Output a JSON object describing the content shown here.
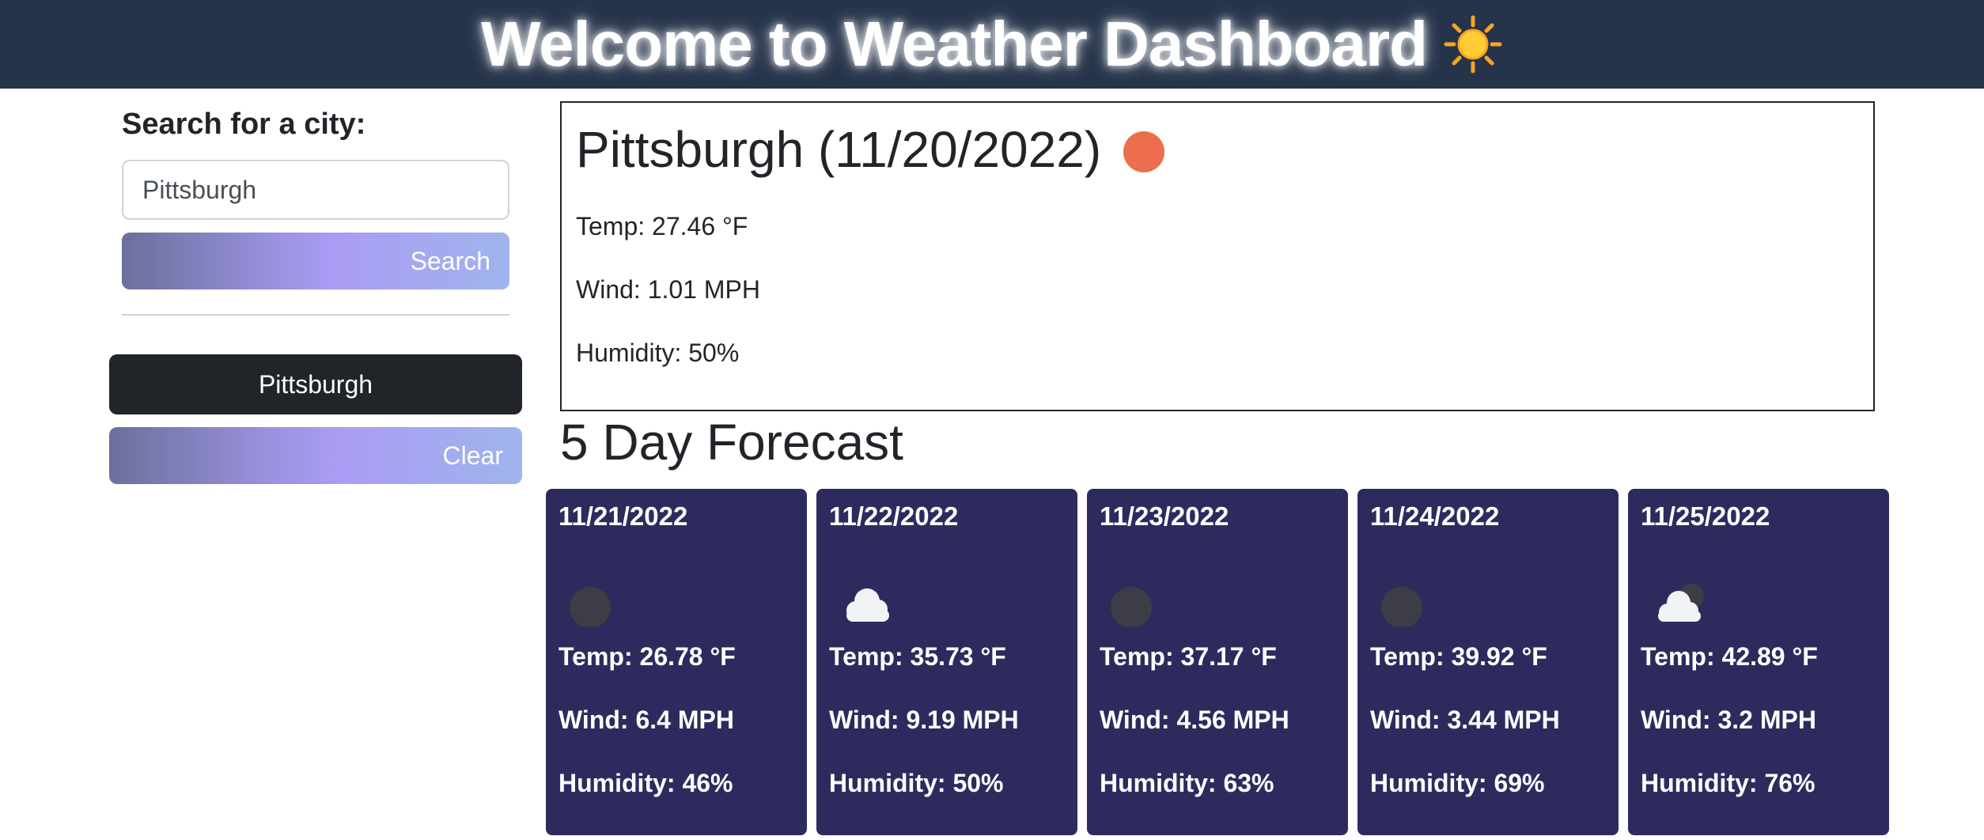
{
  "header": {
    "title": "Welcome to Weather Dashboard",
    "icon": "sun-icon"
  },
  "sidebar": {
    "search_label": "Search for a city:",
    "search_input_value": "Pittsburgh",
    "search_button": "Search",
    "history": [
      "Pittsburgh"
    ],
    "clear_button": "Clear"
  },
  "current": {
    "title": "Pittsburgh (11/20/2022)",
    "icon": "clear-night-icon",
    "icon_color": "#ec6e4c",
    "temp": "Temp: 27.46 °F",
    "wind": "Wind: 1.01 MPH",
    "humidity": "Humidity: 50%"
  },
  "forecast": {
    "title": "5 Day Forecast",
    "days": [
      {
        "date": "11/21/2022",
        "icon": "moon-icon",
        "temp": "Temp: 26.78 °F",
        "wind": "Wind: 6.4 MPH",
        "humidity": "Humidity: 46%"
      },
      {
        "date": "11/22/2022",
        "icon": "cloud-icon",
        "temp": "Temp: 35.73 °F",
        "wind": "Wind: 9.19 MPH",
        "humidity": "Humidity: 50%"
      },
      {
        "date": "11/23/2022",
        "icon": "moon-icon",
        "temp": "Temp: 37.17 °F",
        "wind": "Wind: 4.56 MPH",
        "humidity": "Humidity: 63%"
      },
      {
        "date": "11/24/2022",
        "icon": "moon-icon",
        "temp": "Temp: 39.92 °F",
        "wind": "Wind: 3.44 MPH",
        "humidity": "Humidity: 69%"
      },
      {
        "date": "11/25/2022",
        "icon": "partly-cloudy-night-icon",
        "temp": "Temp: 42.89 °F",
        "wind": "Wind: 3.2 MPH",
        "humidity": "Humidity: 76%"
      }
    ]
  },
  "colors": {
    "header_bg": "#26344b",
    "card_bg": "#2d2b5e",
    "history_bg": "#212529"
  }
}
